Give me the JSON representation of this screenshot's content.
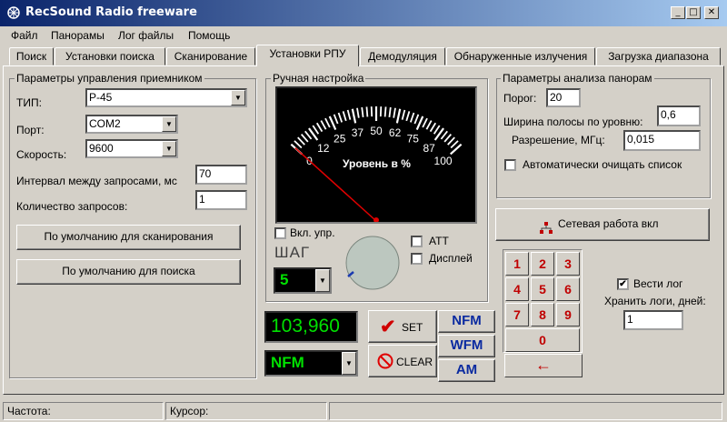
{
  "window": {
    "title": "RecSound Radio freeware",
    "minimize": "_",
    "maximize": "□",
    "close": "✕"
  },
  "menu": [
    "Файл",
    "Панорамы",
    "Лог файлы",
    "Помощь"
  ],
  "tabs": [
    "Поиск",
    "Установки поиска",
    "Сканирование",
    "Установки РПУ",
    "Демодуляция",
    "Обнаруженные излучения",
    "Загрузка диапазона"
  ],
  "receiver": {
    "group_title": "Параметры управления приемником",
    "type_label": "ТИП:",
    "type_value": "P-45",
    "port_label": "Порт:",
    "port_value": "COM2",
    "speed_label": "Скорость:",
    "speed_value": "9600",
    "interval_label": "Интервал между запросами, мс",
    "interval_value": "70",
    "count_label": "Количество запросов:",
    "count_value": "1",
    "default_scan": "По умолчанию для сканирования",
    "default_search": "По умолчанию для поиска"
  },
  "manual": {
    "group_title": "Ручная настройка",
    "meter_label": "Уровень в %",
    "meter_ticks": [
      "0",
      "12",
      "25",
      "37",
      "50",
      "62",
      "75",
      "87",
      "100"
    ],
    "meter_level": 0,
    "vkl_upr_label": "Вкл. упр.",
    "step_label": "ШАГ",
    "step_value": "5",
    "att_label": "ATT",
    "display_label": "Дисплей",
    "frequency": "103,960",
    "mode": "NFM",
    "set": "SET",
    "clear": "CLEAR",
    "mode_buttons": [
      "NFM",
      "WFM",
      "AM"
    ]
  },
  "panorama": {
    "group_title": "Параметры анализа панорам",
    "threshold_label": "Порог:",
    "threshold_value": "20",
    "bandwidth_label": "Ширина полосы по уровню:",
    "bandwidth_value": "0,6",
    "resolution_label": "Разрешение, МГц:",
    "resolution_value": "0,015",
    "autoclear_label": "Автоматически очищать список"
  },
  "network_button": "Сетевая работа вкл",
  "keypad": [
    "1",
    "2",
    "3",
    "4",
    "5",
    "6",
    "7",
    "8",
    "9",
    "0"
  ],
  "backspace": "←",
  "log": {
    "keep_label": "Вести лог",
    "keep_checked": "✔",
    "days_label": "Хранить логи, дней:",
    "days_value": "1"
  },
  "status": {
    "freq": "Частота:",
    "cursor": "Курсор:"
  },
  "colors": {
    "lcd": "#00e000",
    "accent": "#0a246a",
    "key": "#c00000"
  }
}
